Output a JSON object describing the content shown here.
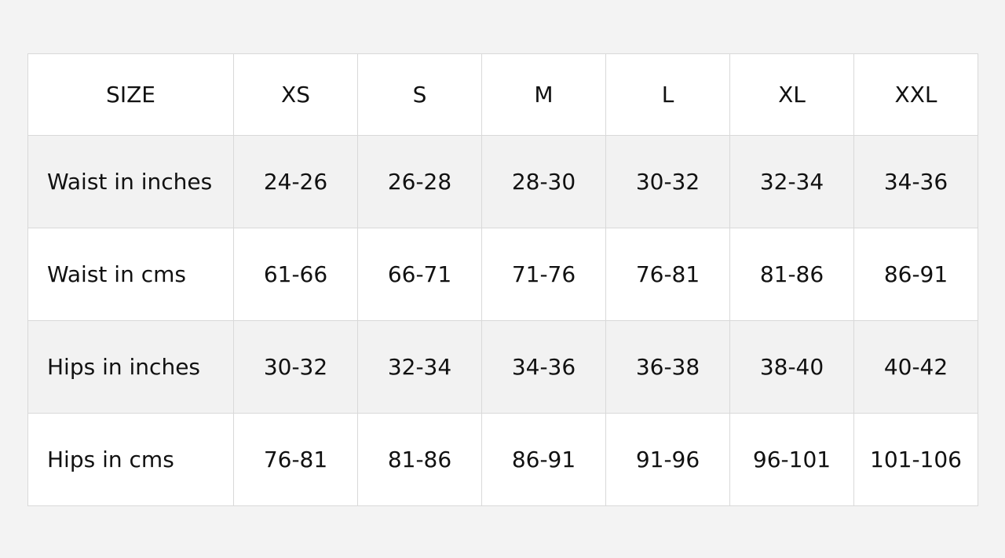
{
  "table": {
    "header": [
      "SIZE",
      "XS",
      "S",
      "M",
      "L",
      "XL",
      "XXL"
    ],
    "rows": [
      {
        "label": "Waist in inches",
        "values": [
          "24-26",
          "26-28",
          "28-30",
          "30-32",
          "32-34",
          "34-36"
        ]
      },
      {
        "label": "Waist in cms",
        "values": [
          "61-66",
          "66-71",
          "71-76",
          "76-81",
          "81-86",
          "86-91"
        ]
      },
      {
        "label": "Hips in inches",
        "values": [
          "30-32",
          "32-34",
          "34-36",
          "36-38",
          "38-40",
          "40-42"
        ]
      },
      {
        "label": "Hips in cms",
        "values": [
          "76-81",
          "81-86",
          "86-91",
          "91-96",
          "96-101",
          "101-106"
        ]
      }
    ]
  },
  "colors": {
    "page_background": "#f3f3f3",
    "stripe": "#f2f2f2",
    "border": "#d9d9d9"
  }
}
